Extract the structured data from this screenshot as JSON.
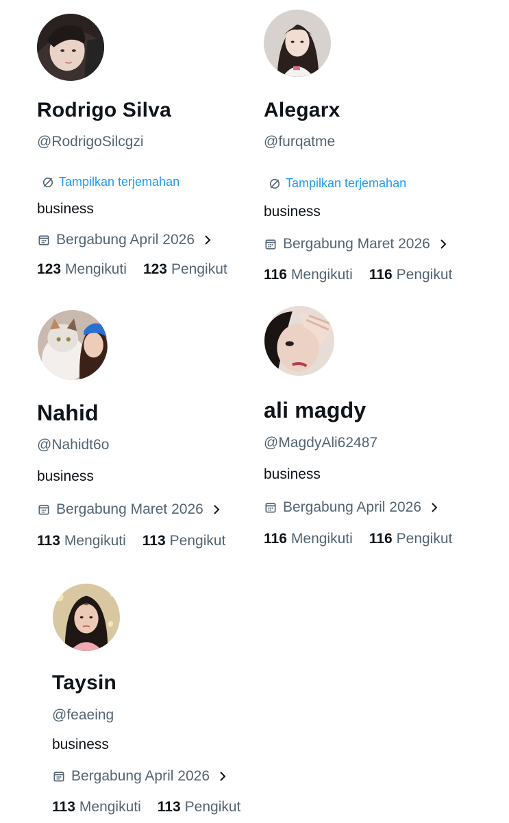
{
  "profiles": [
    {
      "name": "Rodrigo Silva",
      "handle": "@RodrigoSilcgzi",
      "translate_label": "Tampilkan terjemahan",
      "bio": "business",
      "joined": "Bergabung April 2026",
      "following_count": "123",
      "following_label": "Mengikuti",
      "followers_count": "123",
      "followers_label": "Pengikut"
    },
    {
      "name": "Alegarx",
      "handle": "@furqatme",
      "translate_label": "Tampilkan terjemahan",
      "bio": "business",
      "joined": "Bergabung Maret 2026",
      "following_count": "116",
      "following_label": "Mengikuti",
      "followers_count": "116",
      "followers_label": "Pengikut"
    },
    {
      "name": "Nahid",
      "handle": "@Nahidt6o",
      "bio": "business",
      "joined": "Bergabung Maret 2026",
      "following_count": "113",
      "following_label": "Mengikuti",
      "followers_count": "113",
      "followers_label": "Pengikut"
    },
    {
      "name": "ali magdy",
      "handle": "@MagdyAli62487",
      "bio": "business",
      "joined": "Bergabung April 2026",
      "following_count": "116",
      "following_label": "Mengikuti",
      "followers_count": "116",
      "followers_label": "Pengikut"
    },
    {
      "name": "Taysin",
      "handle": "@feaeing",
      "bio": "business",
      "joined": "Bergabung April 2026",
      "following_count": "113",
      "following_label": "Mengikuti",
      "followers_count": "113",
      "followers_label": "Pengikut"
    }
  ],
  "colors": {
    "text_primary": "#0f1419",
    "text_secondary": "#536471",
    "link": "#1d9bf0"
  },
  "icons": {
    "translate": "translate-icon",
    "calendar": "calendar-icon",
    "chevron": "chevron-right-icon"
  }
}
